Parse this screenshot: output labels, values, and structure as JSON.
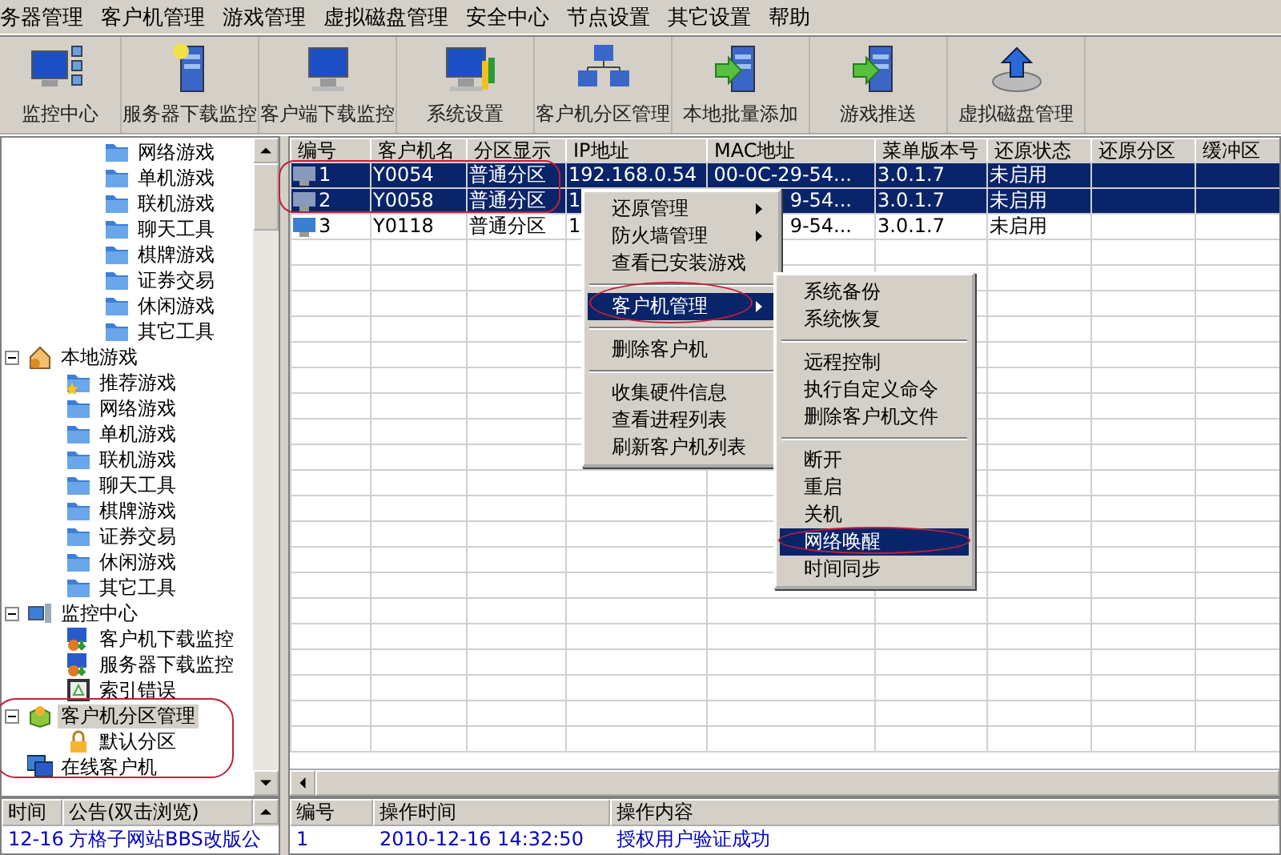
{
  "menu_bar": [
    {
      "label": "务器管理"
    },
    {
      "label": "客户机管理"
    },
    {
      "label": "游戏管理"
    },
    {
      "label": "虚拟磁盘管理"
    },
    {
      "label": "安全中心"
    },
    {
      "label": "节点设置"
    },
    {
      "label": "其它设置"
    },
    {
      "label": "帮助"
    }
  ],
  "toolbar": [
    {
      "label": "监控中心",
      "kind": "monitor"
    },
    {
      "label": "服务器下载监控",
      "kind": "server"
    },
    {
      "label": "客户端下载监控",
      "kind": "computer"
    },
    {
      "label": "系统设置",
      "kind": "settings"
    },
    {
      "label": "客户机分区管理",
      "kind": "network"
    },
    {
      "label": "本地批量添加",
      "kind": "add"
    },
    {
      "label": "游戏推送",
      "kind": "push"
    },
    {
      "label": "虚拟磁盘管理",
      "kind": "disk"
    }
  ],
  "tree": {
    "scrolled_items": [
      {
        "label": "网络游戏",
        "kind": "folder",
        "selected": false
      },
      {
        "label": "单机游戏",
        "kind": "folder",
        "selected": false
      },
      {
        "label": "联机游戏",
        "kind": "folder",
        "selected": false
      },
      {
        "label": "聊天工具",
        "kind": "folder",
        "selected": false
      },
      {
        "label": "棋牌游戏",
        "kind": "folder",
        "selected": false
      },
      {
        "label": "证券交易",
        "kind": "folder",
        "selected": false
      },
      {
        "label": "休闲游戏",
        "kind": "folder",
        "selected": false
      },
      {
        "label": "其它工具",
        "kind": "folder",
        "selected": false
      }
    ],
    "items": [
      {
        "label": "本地游戏",
        "kind": "home",
        "selected": false,
        "expanded": true,
        "children": [
          {
            "label": "推荐游戏",
            "kind": "star-folder",
            "selected": false
          },
          {
            "label": "网络游戏",
            "kind": "folder",
            "selected": false
          },
          {
            "label": "单机游戏",
            "kind": "folder",
            "selected": false
          },
          {
            "label": "联机游戏",
            "kind": "folder",
            "selected": false
          },
          {
            "label": "聊天工具",
            "kind": "folder",
            "selected": false
          },
          {
            "label": "棋牌游戏",
            "kind": "folder",
            "selected": false
          },
          {
            "label": "证券交易",
            "kind": "folder",
            "selected": false
          },
          {
            "label": "休闲游戏",
            "kind": "folder",
            "selected": false
          },
          {
            "label": "其它工具",
            "kind": "folder",
            "selected": false
          }
        ]
      },
      {
        "label": "监控中心",
        "kind": "monitor",
        "selected": false,
        "expanded": true,
        "children": [
          {
            "label": "客户机下载监控",
            "kind": "download",
            "selected": false
          },
          {
            "label": "服务器下载监控",
            "kind": "download",
            "selected": false
          },
          {
            "label": "索引错误",
            "kind": "index",
            "selected": false
          }
        ]
      },
      {
        "label": "客户机分区管理",
        "kind": "partition",
        "selected": true,
        "expanded": true,
        "children": [
          {
            "label": "默认分区",
            "kind": "lock",
            "selected": false
          }
        ]
      },
      {
        "label": "在线客户机",
        "kind": "clients",
        "selected": false
      }
    ]
  },
  "table": {
    "columns": [
      "编号",
      "客户机名",
      "分区显示",
      "IP地址",
      "MAC地址",
      "菜单版本号",
      "还原状态",
      "还原分区",
      "缓冲区"
    ],
    "rows": [
      {
        "selected": true,
        "cells": [
          "1",
          "Y0054",
          "普通分区",
          "192.168.0.54",
          "00-0C-29-54...",
          "3.0.1.7",
          "未启用"
        ]
      },
      {
        "selected": true,
        "cells": [
          "2",
          "Y0058",
          "普通分区",
          "1",
          "9-54...",
          "3.0.1.7",
          "未启用"
        ]
      },
      {
        "selected": false,
        "cells": [
          "3",
          "Y0118",
          "普通分区",
          "1",
          "9-54...",
          "3.0.1.7",
          "未启用"
        ]
      }
    ]
  },
  "context_menu": {
    "groups": [
      [
        {
          "label": "还原管理",
          "submenu": true,
          "selected": false
        },
        {
          "label": "防火墙管理",
          "submenu": true,
          "selected": false
        },
        {
          "label": "查看已安装游戏",
          "submenu": false,
          "selected": false
        }
      ],
      [
        {
          "label": "客户机管理",
          "submenu": true,
          "selected": true
        }
      ],
      [
        {
          "label": "删除客户机",
          "submenu": false,
          "selected": false
        }
      ],
      [
        {
          "label": "收集硬件信息",
          "submenu": false,
          "selected": false
        },
        {
          "label": "查看进程列表",
          "submenu": false,
          "selected": false
        },
        {
          "label": "刷新客户机列表",
          "submenu": false,
          "selected": false
        }
      ]
    ]
  },
  "submenu": {
    "groups": [
      [
        {
          "label": "系统备份",
          "selected": false
        },
        {
          "label": "系统恢复",
          "selected": false
        }
      ],
      [
        {
          "label": "远程控制",
          "selected": false
        },
        {
          "label": "执行自定义命令",
          "selected": false
        },
        {
          "label": "删除客户机文件",
          "selected": false
        }
      ],
      [
        {
          "label": "断开",
          "selected": false
        },
        {
          "label": "重启",
          "selected": false
        },
        {
          "label": "关机",
          "selected": false
        },
        {
          "label": "网络唤醒",
          "selected": true
        },
        {
          "label": "时间同步",
          "selected": false
        }
      ]
    ]
  },
  "notice_panel": {
    "columns": [
      "时间",
      "公告(双击浏览)"
    ],
    "rows": [
      [
        "12-16",
        "方格子网站BBS改版公"
      ]
    ]
  },
  "log_panel": {
    "columns": [
      "编号",
      "操作时间",
      "操作内容"
    ],
    "rows": [
      [
        "1",
        "2010-12-16 14:32:50",
        "授权用户验证成功"
      ]
    ]
  }
}
